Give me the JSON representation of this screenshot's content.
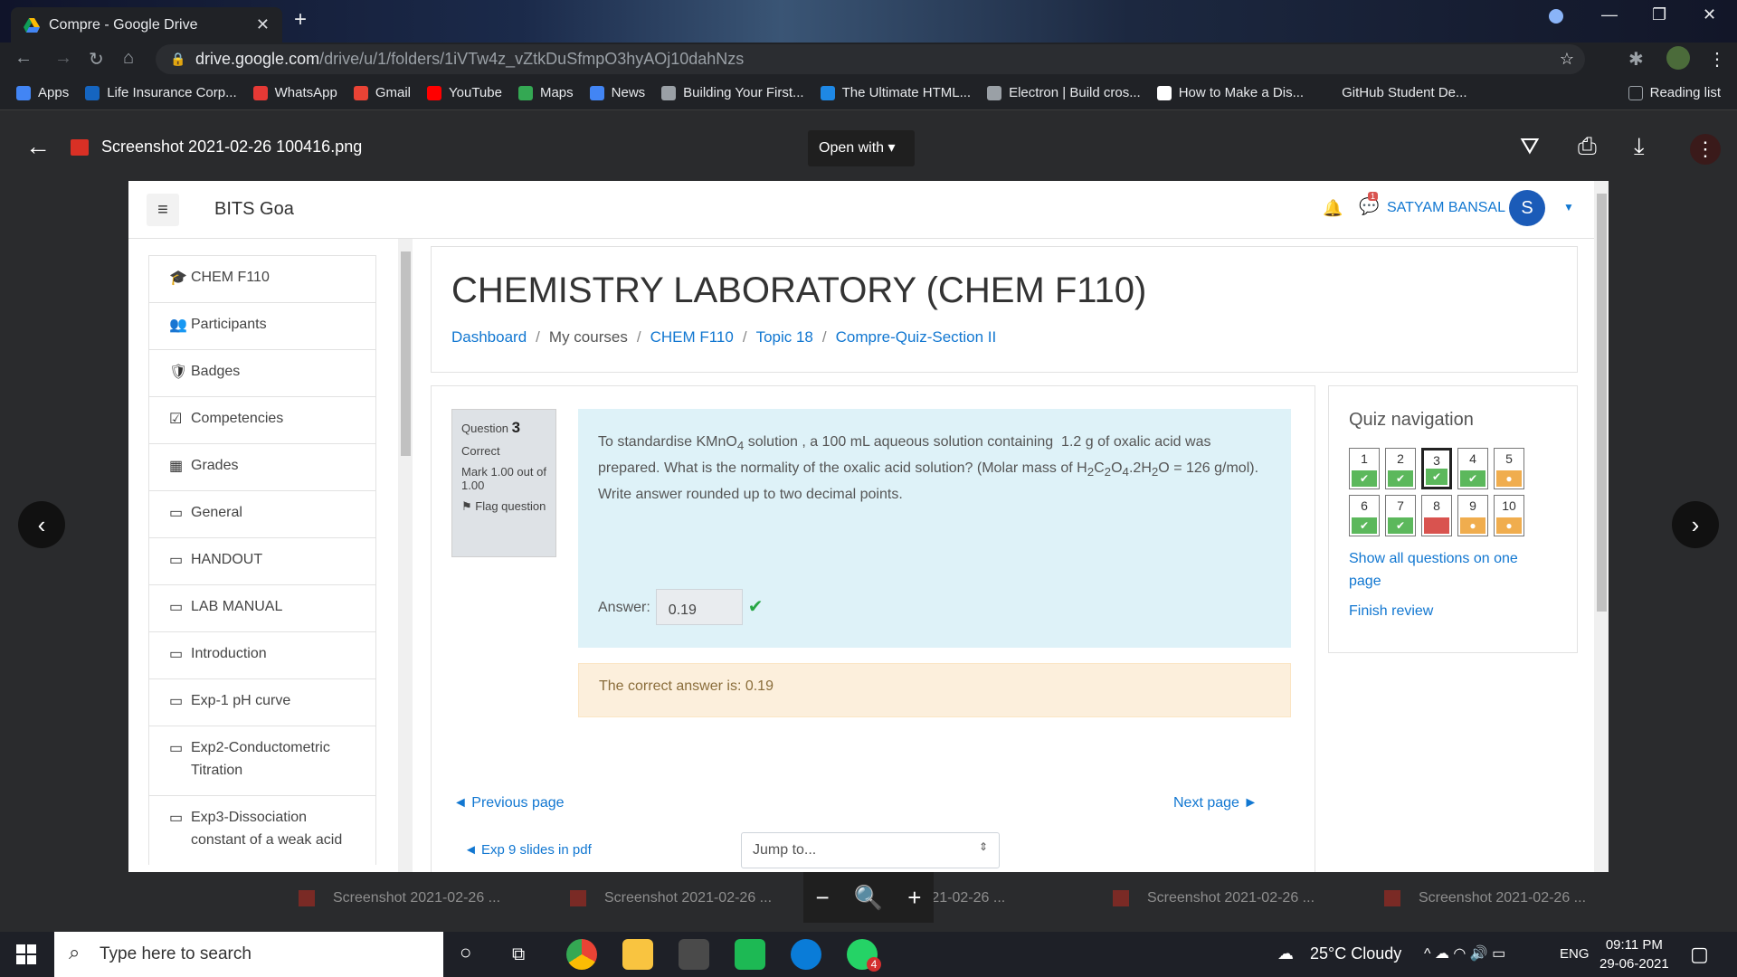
{
  "browser": {
    "tab_title": "Compre - Google Drive",
    "url_host": "drive.google.com",
    "url_path": "/drive/u/1/folders/1iVTw4z_vZtkDuSfmpO3hyAOj10dahNzs",
    "bookmarks": [
      {
        "label": "Apps",
        "color": "#4285f4"
      },
      {
        "label": "Life Insurance Corp...",
        "color": "#1565c0"
      },
      {
        "label": "WhatsApp",
        "color": "#e53935"
      },
      {
        "label": "Gmail",
        "color": "#ea4335"
      },
      {
        "label": "YouTube",
        "color": "#ff0000"
      },
      {
        "label": "Maps",
        "color": "#34a853"
      },
      {
        "label": "News",
        "color": "#4285f4"
      },
      {
        "label": "Building Your First...",
        "color": "#9aa0a6"
      },
      {
        "label": "The Ultimate HTML...",
        "color": "#1e88e5"
      },
      {
        "label": "Electron | Build cros...",
        "color": "#9aa0a6"
      },
      {
        "label": "How to Make a Dis...",
        "color": "#ffffff"
      },
      {
        "label": "GitHub Student De...",
        "color": "#202226"
      }
    ],
    "reading_list": "Reading list"
  },
  "viewer": {
    "file_name": "Screenshot 2021-02-26 100416.png",
    "open_with": "Open with",
    "thumbnails": [
      "Screenshot 2021-02-26 ...",
      "Screenshot 2021-02-26 ...",
      "nshot 2021-02-26 ...",
      "Screenshot 2021-02-26 ...",
      "Screenshot 2021-02-26 ..."
    ]
  },
  "moodle": {
    "brand": "BITS Goa",
    "user_name": "SATYAM BANSAL",
    "avatar_letter": "S",
    "msg_count": "1",
    "sidebar": [
      {
        "icon": "🎓",
        "label": "CHEM F110",
        "tall": false
      },
      {
        "icon": "👥",
        "label": "Participants",
        "tall": false
      },
      {
        "icon": "🛡",
        "label": "Badges",
        "tall": false
      },
      {
        "icon": "☑",
        "label": "Competencies",
        "tall": false
      },
      {
        "icon": "▦",
        "label": "Grades",
        "tall": false
      },
      {
        "icon": "▭",
        "label": "General",
        "tall": false
      },
      {
        "icon": "▭",
        "label": "HANDOUT",
        "tall": false
      },
      {
        "icon": "▭",
        "label": "LAB MANUAL",
        "tall": false
      },
      {
        "icon": "▭",
        "label": "Introduction",
        "tall": false
      },
      {
        "icon": "▭",
        "label": "Exp-1 pH curve",
        "tall": false
      },
      {
        "icon": "▭",
        "label": "Exp2-Conductometric Titration",
        "tall": true
      },
      {
        "icon": "▭",
        "label": "Exp3-Dissociation constant of a weak acid",
        "tall": true
      }
    ],
    "course_title": "CHEMISTRY LABORATORY (CHEM F110)",
    "breadcrumb": [
      "Dashboard",
      "My courses",
      "CHEM F110",
      "Topic 18",
      "Compre-Quiz-Section II"
    ],
    "question": {
      "label": "Question",
      "number": "3",
      "status": "Correct",
      "mark": "Mark 1.00 out of 1.00",
      "flag": "Flag question",
      "text_html": "To standardise KMnO<sub>4</sub> solution , a 100 mL aqueous solution containing &nbsp;1.2 g of oxalic acid was prepared. What is the normality of the oxalic acid solution? (Molar mass of H<sub>2</sub>C<sub>2</sub>O<sub>4</sub>.2H<sub>2</sub>O = 126 g/mol).<br>Write answer rounded up to two decimal points.",
      "answer_label": "Answer:",
      "answer_value": "0.19",
      "correct_answer": "The correct answer is: 0.19"
    },
    "prev_page": "◄ Previous page",
    "next_page": "Next page ►",
    "prev_activity": "◄ Exp 9 slides in pdf",
    "jump_to": "Jump to...",
    "quiz_nav": {
      "title": "Quiz navigation",
      "questions": [
        {
          "n": "1",
          "state": "correct"
        },
        {
          "n": "2",
          "state": "correct"
        },
        {
          "n": "3",
          "state": "correct",
          "current": true
        },
        {
          "n": "4",
          "state": "correct"
        },
        {
          "n": "5",
          "state": "partial"
        },
        {
          "n": "6",
          "state": "correct"
        },
        {
          "n": "7",
          "state": "correct"
        },
        {
          "n": "8",
          "state": "incorrect"
        },
        {
          "n": "9",
          "state": "partial"
        },
        {
          "n": "10",
          "state": "partial"
        }
      ],
      "show_all": "Show all questions on one page",
      "finish": "Finish review",
      "colors": {
        "correct": "#5cb85c",
        "partial": "#f0ad4e",
        "incorrect": "#d9534f"
      }
    }
  },
  "taskbar": {
    "search_placeholder": "Type here to search",
    "weather": "25°C  Cloudy",
    "lang": "ENG",
    "time": "09:11 PM",
    "date": "29-06-2021",
    "whatsapp_badge": "4"
  }
}
